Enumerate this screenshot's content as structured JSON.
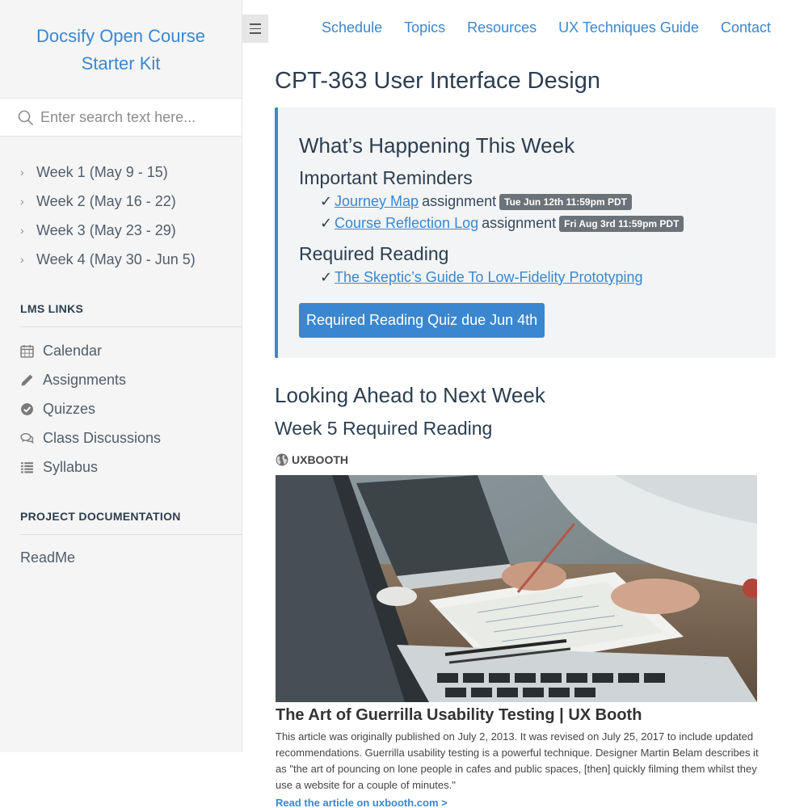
{
  "sidebar": {
    "app_name_line1": "Docsify Open Course",
    "app_name_line2": "Starter Kit",
    "search_placeholder": "Enter search text here...",
    "weeks": [
      {
        "label": "Week 1 (May 9 - 15)"
      },
      {
        "label": "Week 2 (May 16 - 22)"
      },
      {
        "label": "Week 3 (May 23 - 29)"
      },
      {
        "label": "Week 4 (May 30 - Jun 5)"
      }
    ],
    "lms_heading": "LMS LINKS",
    "lms_items": [
      {
        "label": "Calendar",
        "icon": "calendar-icon"
      },
      {
        "label": "Assignments",
        "icon": "pencil-icon"
      },
      {
        "label": "Quizzes",
        "icon": "check-circle-icon"
      },
      {
        "label": "Class Discussions",
        "icon": "comments-icon"
      },
      {
        "label": "Syllabus",
        "icon": "list-icon"
      }
    ],
    "project_heading": "PROJECT DOCUMENTATION",
    "readme": "ReadMe"
  },
  "nav": [
    "Schedule",
    "Topics",
    "Resources",
    "UX Techniques Guide",
    "Contact"
  ],
  "main": {
    "title": "CPT-363 User Interface Design",
    "tip": {
      "heading": "What’s Happening This Week",
      "reminders_heading": "Important Reminders",
      "reminders": [
        {
          "check": "✓",
          "link": "Journey Map",
          "text": "assignment",
          "badge": "Tue Jun 12th 11:59pm PDT"
        },
        {
          "check": "✓",
          "link": "Course Reflection Log",
          "text": "assignment",
          "badge": "Fri Aug 3rd 11:59pm PDT"
        }
      ],
      "reading_heading": "Required Reading",
      "reading": {
        "check": "✓",
        "link": "The Skeptic’s Guide To Low-Fidelity Prototyping"
      },
      "quiz_button": "Required Reading Quiz due Jun 4th"
    },
    "ahead_heading": "Looking Ahead to Next Week",
    "week5_heading": "Week 5 Required Reading",
    "card": {
      "site": "UXBOOTH",
      "title": "The Art of Guerrilla Usability Testing | UX Booth",
      "description": "This article was originally published on July 2, 2013. It was revised on July 25, 2017 to include updated recommendations. Guerrilla usability testing is a powerful technique. Designer Martin Belam describes it as \"the art of pouncing on lone people in cafes and public spaces, [then] quickly filming them whilst they use a website for a couple of minutes.\"",
      "more": "Read the article on uxbooth.com >"
    }
  },
  "colors": {
    "accent": "#3b87cf",
    "sidebar_bg": "#f5f5f5",
    "tip_bg": "#f3f4f5",
    "badge_bg": "#6b7278"
  }
}
